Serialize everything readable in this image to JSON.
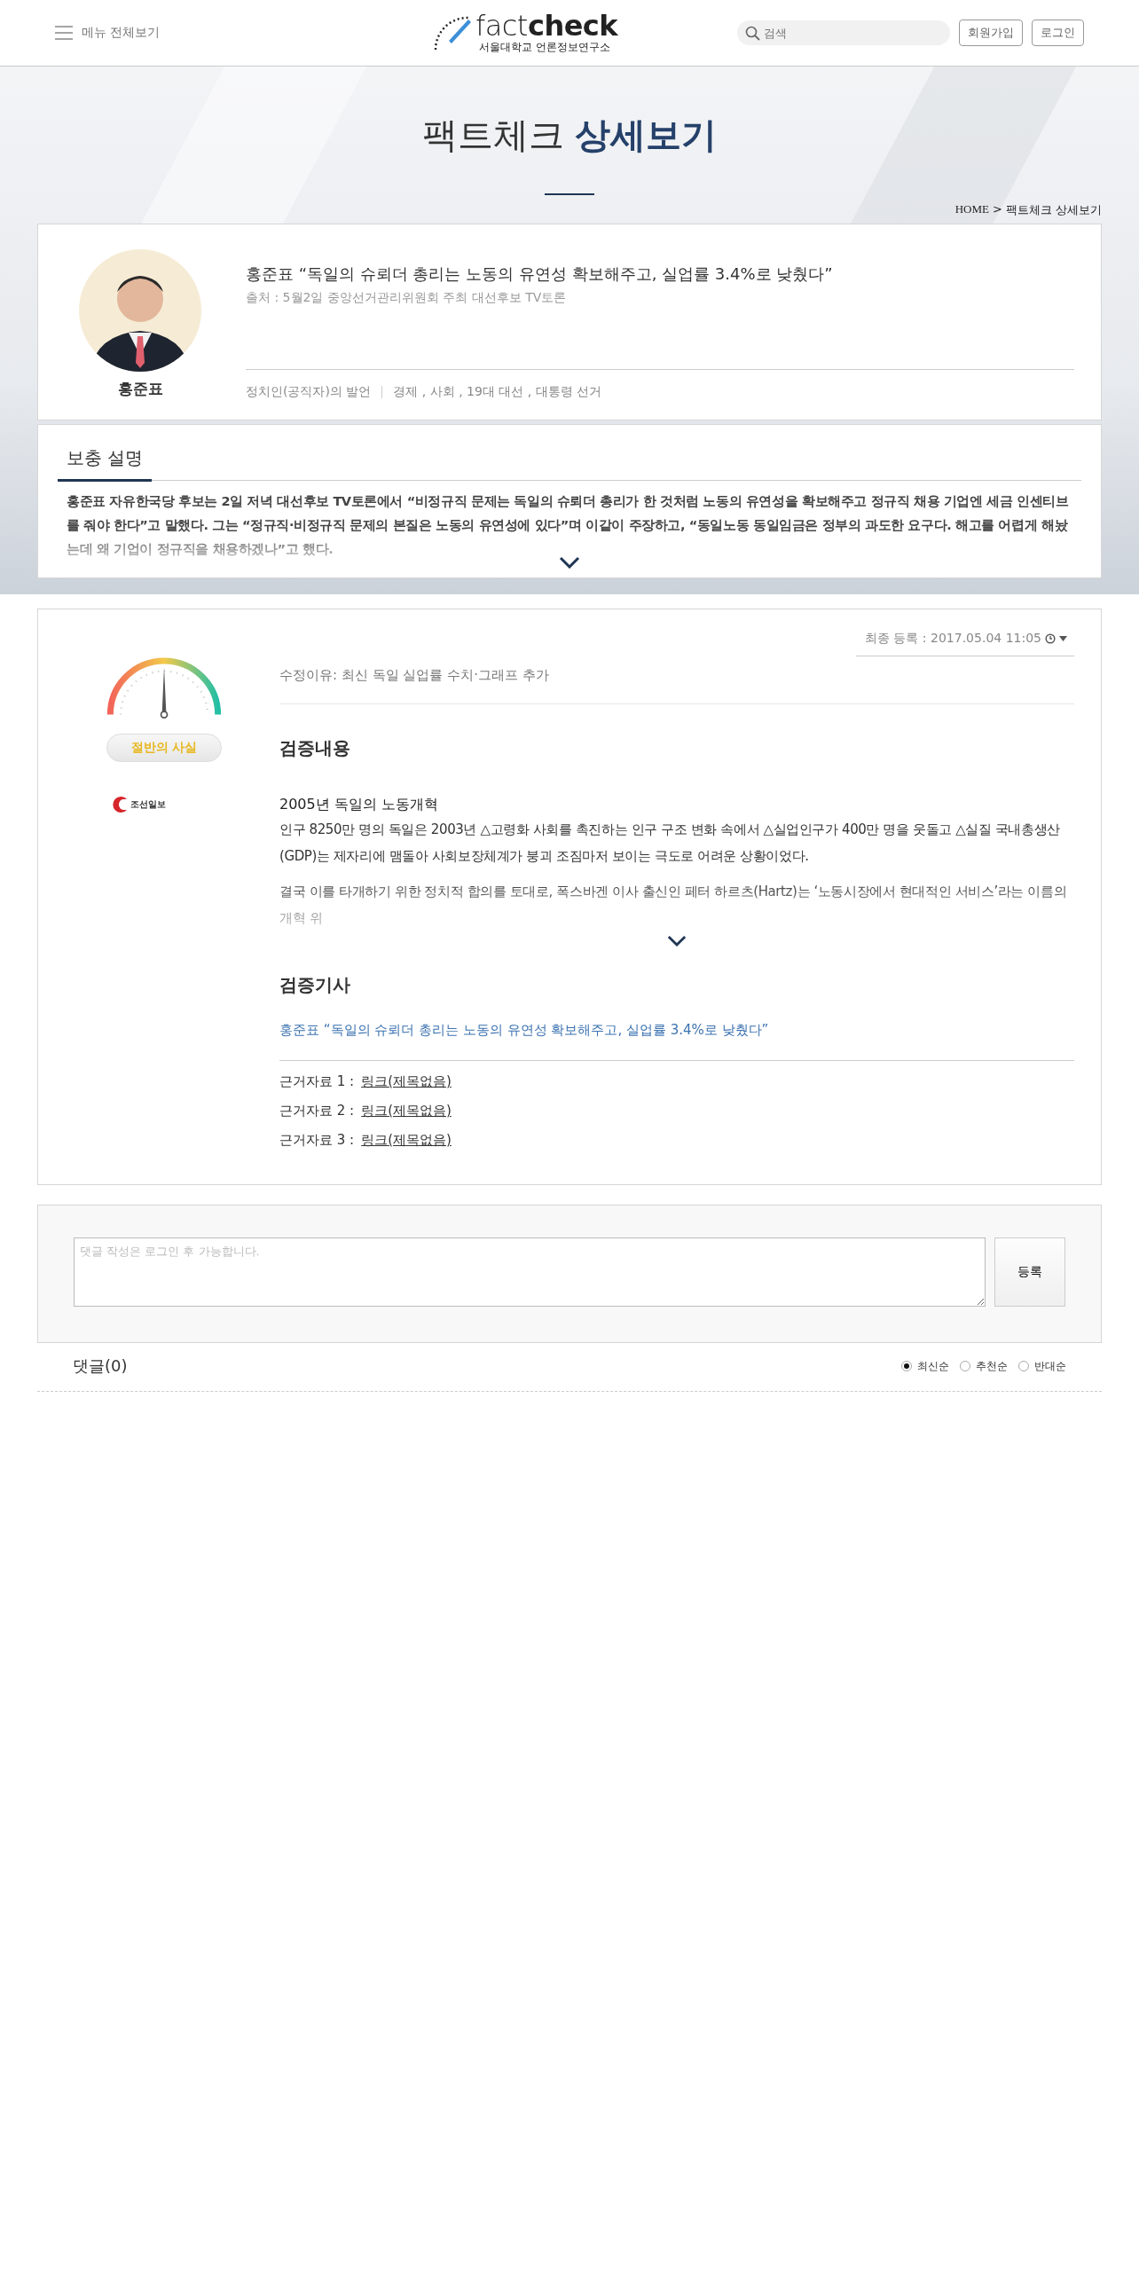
{
  "header": {
    "menu_label": "메뉴 전체보기",
    "logo": {
      "light": "fact",
      "bold": "check",
      "subtitle": "서울대학교 언론정보연구소"
    },
    "search": {
      "placeholder": "검색"
    },
    "buttons": [
      "회원가입",
      "로그인"
    ]
  },
  "hero": {
    "title_light": "팩트체크",
    "title_bold": "상세보기",
    "breadcrumb": {
      "home": "HOME",
      "separator": ">",
      "current": "팩트체크 상세보기"
    }
  },
  "claim": {
    "speaker": "홍준표",
    "title": "홍준표 “독일의 슈뢰더 총리는 노동의 유연성 확보해주고, 실업률 3.4%로 낮췄다”",
    "source": "출처 : 5월2일 중앙선거관리위원회 주최 대선후보 TV토론",
    "category": "정치인(공직자)의 발언",
    "tags": "경제 , 사회 , 19대 대선 , 대통령 선거"
  },
  "supplement": {
    "heading": "보충 설명",
    "text": "홍준표 자유한국당 후보는 2일 저녁 대선후보 TV토론에서  “비정규직 문제는 독일의 슈뢰더 총리가 한 것처럼 노동의 유연성을 확보해주고 정규직 채용 기업엔 세금 인센티브를 줘야 한다”고 말했다. 그는 “정규직·비정규직 문제의 본질은 노동의 유연성에 있다”며 이같이 주장하고, “동일노동 동일임금은 정부의 과도한 요구다. 해고를 어렵게 해놨는데 왜 기업이 정규직을 채용하겠나”고 했다.",
    "expanded": false
  },
  "verdict": {
    "level": 0.5,
    "label": "절반의 사실",
    "media": {
      "name": "조선일보"
    }
  },
  "verification": {
    "last_updated": "최종 등록 : 2017.05.04 11:05",
    "revision_reason": "수정이유: 최신 독일 실업률 수치·그래프 추가",
    "content_heading": "검증내용",
    "subheading": "2005년 독일의 노동개혁",
    "paragraphs": [
      "인구 8250만 명의 독일은 2003년 △고령화 사회를 촉진하는 인구 구조 변화 속에서 △실업인구가 400만 명을 웃돌고  △실질 국내총생산(GDP)는 제자리에 맴돌아 사회보장체계가 붕괴 조짐마저 보이는 극도로 어려운 상황이었다.",
      "결국 이를 타개하기 위한 정치적 합의를 토대로, 폭스바겐 이사 출신인 페터 하르츠(Hartz)는 ‘노동시장에서 현대적인 서비스’라는 이름의 개혁 위"
    ],
    "expanded": false,
    "article_heading": "검증기사",
    "article_link": "홍준표 “독일의 슈뢰더 총리는 노동의 유연성 확보해주고, 실업률 3.4%로 낮췄다”",
    "sources": [
      {
        "label": "근거자료 1 :",
        "link": "링크(제목없음)"
      },
      {
        "label": "근거자료 2 :",
        "link": "링크(제목없음)"
      },
      {
        "label": "근거자료 3 :",
        "link": "링크(제목없음)"
      }
    ]
  },
  "comment_form": {
    "placeholder": "댓글 작성은 로그인 후 가능합니다.",
    "submit": "등록"
  },
  "comments": {
    "count_label": "댓글(0)",
    "sort_options": [
      {
        "label": "최신순",
        "selected": true
      },
      {
        "label": "추천순",
        "selected": false
      },
      {
        "label": "반대순",
        "selected": false
      }
    ]
  }
}
